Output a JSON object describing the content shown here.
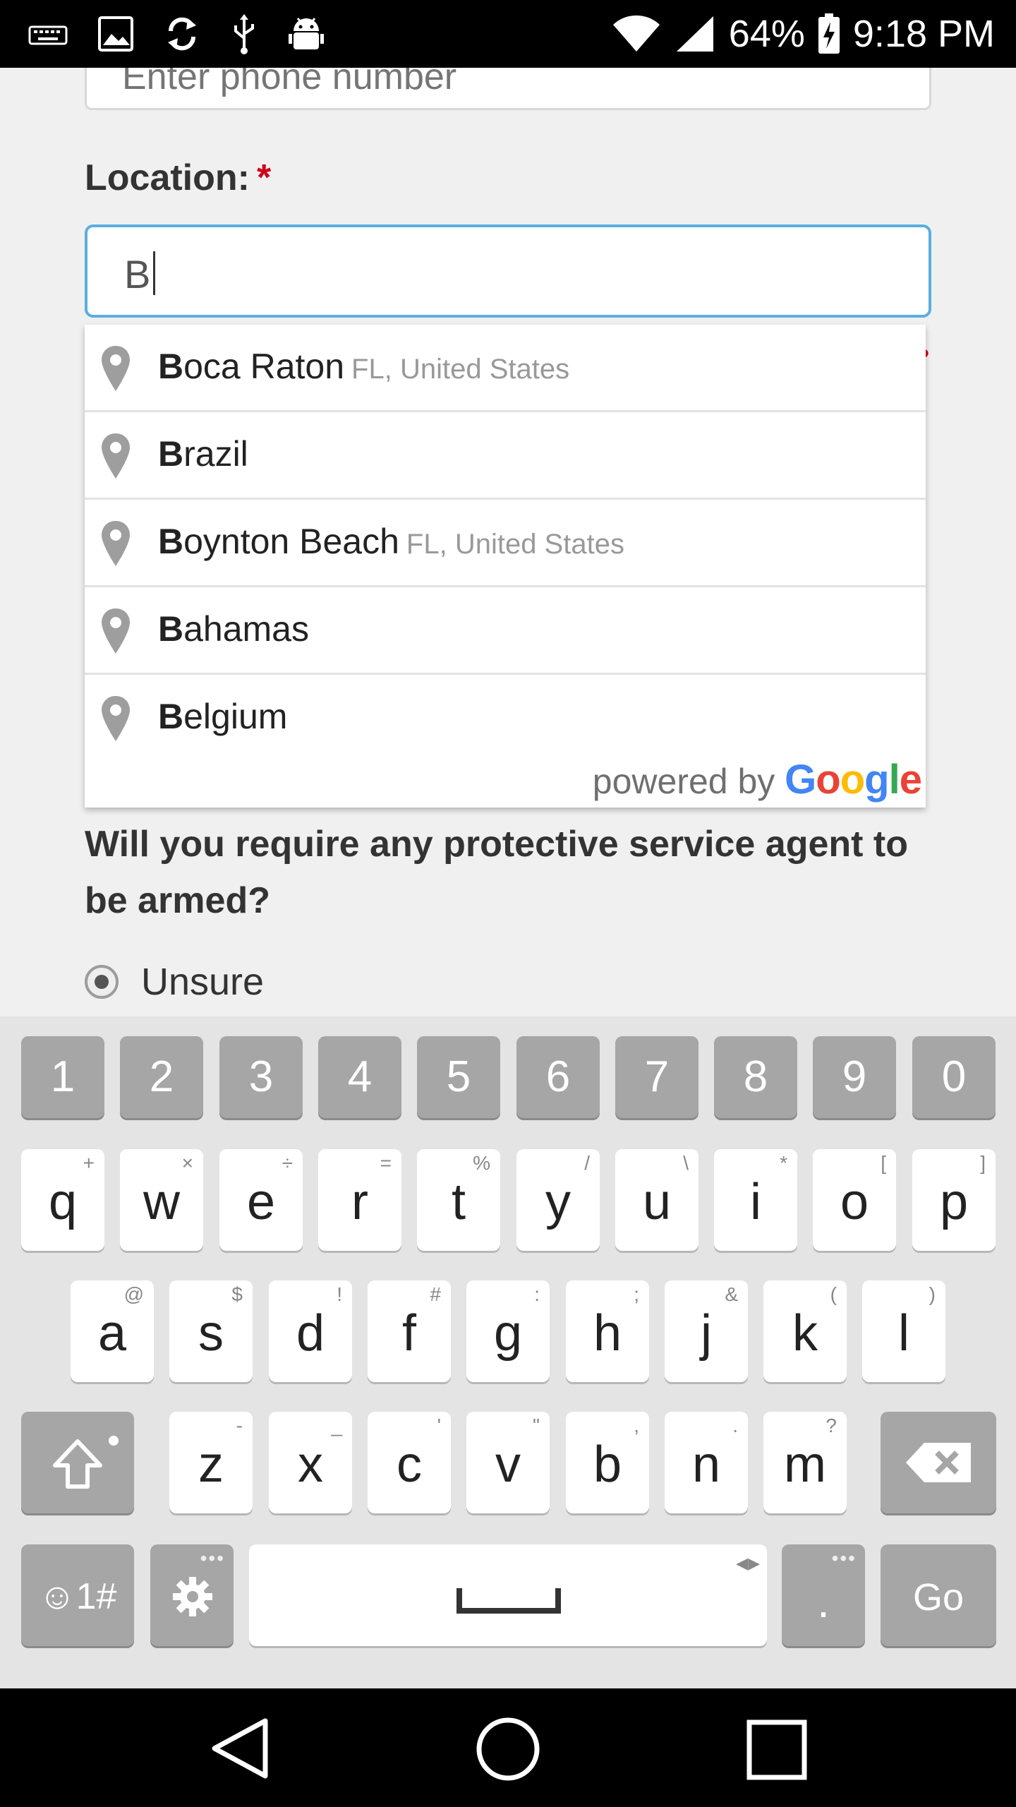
{
  "status_bar": {
    "battery": "64%",
    "time": "9:18 PM",
    "icons": [
      "keyboard-icon",
      "image-icon",
      "sync-icon",
      "usb-icon",
      "android-debug-icon",
      "wifi-icon",
      "signal-icon",
      "battery-charging-icon"
    ]
  },
  "form": {
    "phone_placeholder": "Enter phone number",
    "location_label": "Location:",
    "required_mark": "*",
    "location_value": "B",
    "question": "Will you require any protective service agent to be armed?",
    "radio_unsure": "Unsure"
  },
  "autocomplete": {
    "suggestions": [
      {
        "match": "B",
        "rest": "oca Raton",
        "secondary": "FL, United States"
      },
      {
        "match": "B",
        "rest": "razil",
        "secondary": ""
      },
      {
        "match": "B",
        "rest": "oynton Beach",
        "secondary": "FL, United States"
      },
      {
        "match": "B",
        "rest": "ahamas",
        "secondary": ""
      },
      {
        "match": "B",
        "rest": "elgium",
        "secondary": ""
      }
    ],
    "powered_by": "powered by",
    "google": [
      "G",
      "o",
      "o",
      "g",
      "l",
      "e"
    ]
  },
  "keyboard": {
    "numbers": [
      "1",
      "2",
      "3",
      "4",
      "5",
      "6",
      "7",
      "8",
      "9",
      "0"
    ],
    "row1": [
      [
        "q",
        "+"
      ],
      [
        "w",
        "×"
      ],
      [
        "e",
        "÷"
      ],
      [
        "r",
        "="
      ],
      [
        "t",
        "%"
      ],
      [
        "y",
        "/"
      ],
      [
        "u",
        "\\"
      ],
      [
        "i",
        "*"
      ],
      [
        "o",
        "["
      ],
      [
        "p",
        "]"
      ]
    ],
    "row2": [
      [
        "a",
        "@"
      ],
      [
        "s",
        "$"
      ],
      [
        "d",
        "!"
      ],
      [
        "f",
        "#"
      ],
      [
        "g",
        ":"
      ],
      [
        "h",
        ";"
      ],
      [
        "j",
        "&"
      ],
      [
        "k",
        "("
      ],
      [
        "l",
        ")"
      ]
    ],
    "row3": [
      [
        "z",
        "-"
      ],
      [
        "x",
        "_"
      ],
      [
        "c",
        "'"
      ],
      [
        "v",
        "\""
      ],
      [
        "b",
        ","
      ],
      [
        "n",
        "."
      ],
      [
        "m",
        "?"
      ]
    ],
    "symbols_label": "☺1#",
    "period_label": ".",
    "go_label": "Go"
  },
  "colors": {
    "accent": "#5aaee0",
    "required": "#d0021b",
    "google": [
      "#4285F4",
      "#EA4335",
      "#FBBC05",
      "#4285F4",
      "#34A853",
      "#EA4335"
    ]
  }
}
